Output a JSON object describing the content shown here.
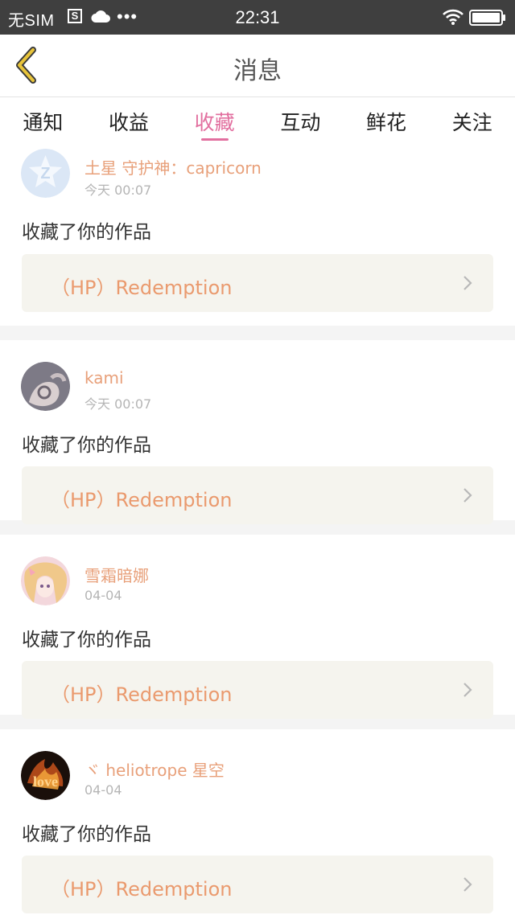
{
  "status_bar": {
    "carrier": "无SIM",
    "sim_icon_glyph": "S",
    "time": "22:31",
    "icons": [
      "sim-icon",
      "cloud-icon",
      "more-dots-icon",
      "wifi-icon",
      "battery-icon"
    ]
  },
  "nav": {
    "title": "消息",
    "back_icon": "chevron-left-icon"
  },
  "tabs": [
    {
      "label": "通知",
      "active": false
    },
    {
      "label": "收益",
      "active": false
    },
    {
      "label": "收藏",
      "active": true
    },
    {
      "label": "互动",
      "active": false
    },
    {
      "label": "鲜花",
      "active": false
    },
    {
      "label": "关注",
      "active": false
    }
  ],
  "notifications": [
    {
      "username": "土星 守护神：capricorn",
      "time": "今天 00:07",
      "action": "收藏了你的作品",
      "work_title": "（HP）Redemption",
      "avatar": "default-avatar-icon"
    },
    {
      "username": "kami",
      "time": "今天 00:07",
      "action": "收藏了你的作品",
      "work_title": "（HP）Redemption",
      "avatar": "user-avatar-photo"
    },
    {
      "username": "雪霜暗娜",
      "time": "04-04",
      "action": "收藏了你的作品",
      "work_title": "（HP）Redemption",
      "avatar": "user-avatar-anime"
    },
    {
      "username": "ヾ heliotrope 星空",
      "time": "04-04",
      "action": "收藏了你的作品",
      "work_title": "（HP）Redemption",
      "avatar": "user-avatar-love"
    }
  ],
  "colors": {
    "accent": "#e26f9f",
    "username": "#e8a07a",
    "work_title": "#ea9a6e",
    "status_bar_bg": "#3f3f3f",
    "back_icon": "#e8c43a"
  }
}
